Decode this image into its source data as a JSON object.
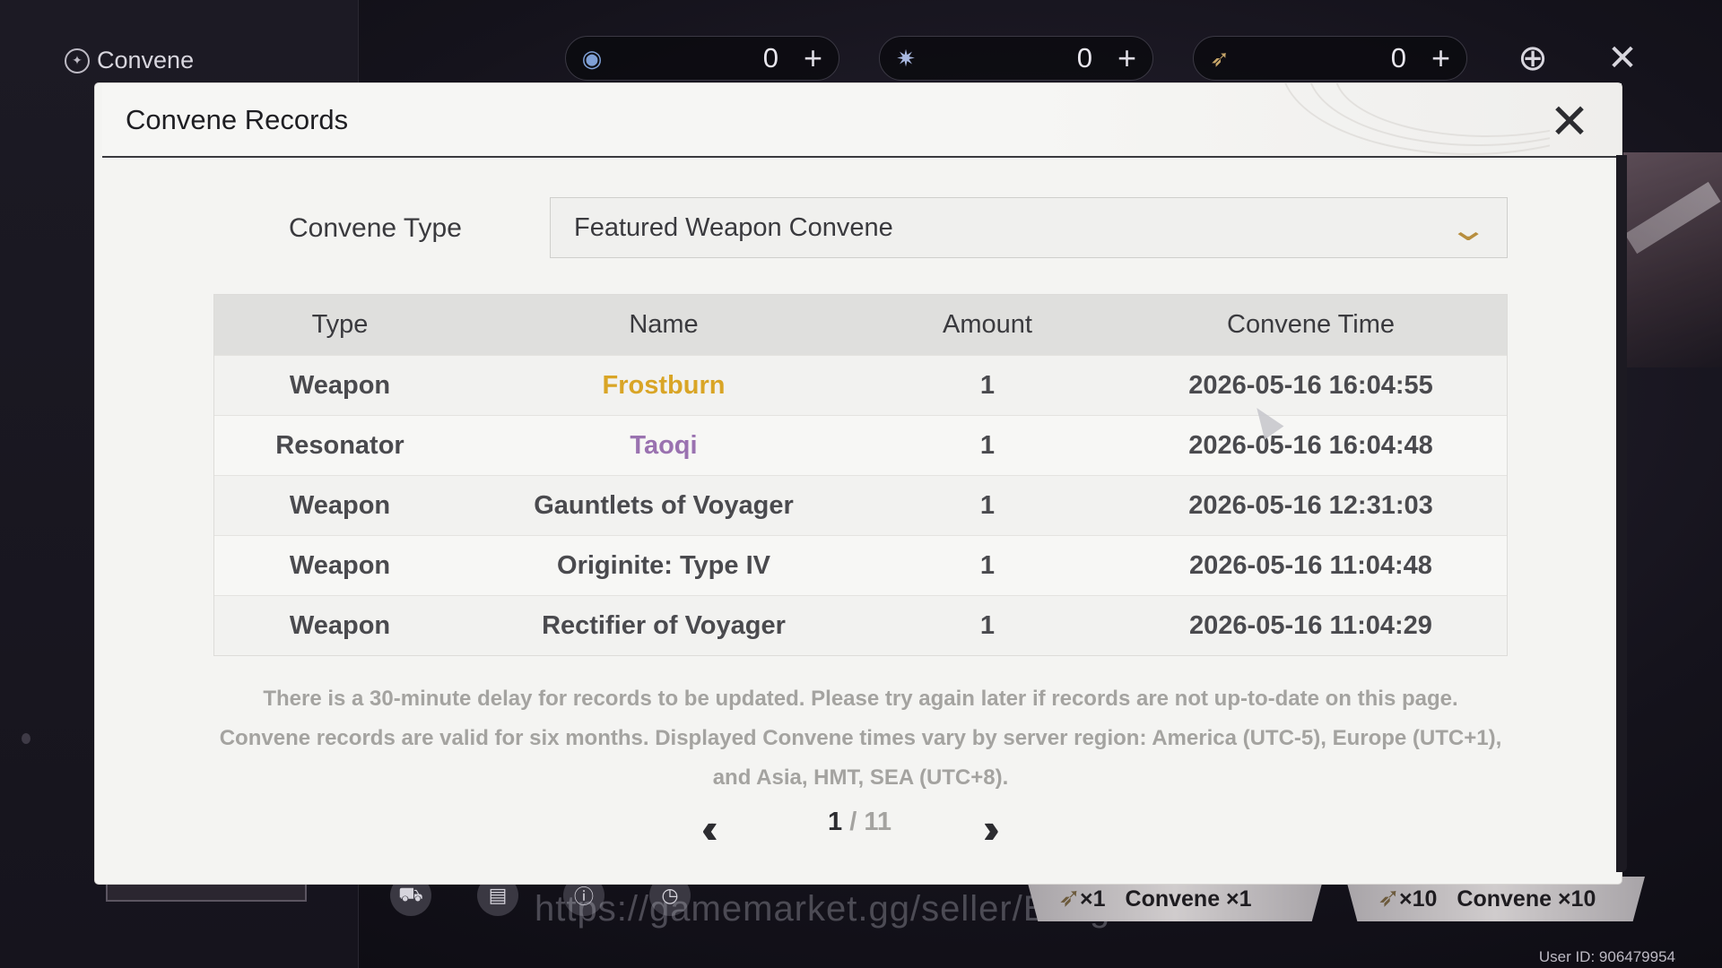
{
  "hud": {
    "title": "Convene",
    "currencies": [
      {
        "icon": "lunite-orb-icon",
        "value": "0",
        "plus": "+"
      },
      {
        "icon": "star-tide-icon",
        "value": "0",
        "plus": "+"
      },
      {
        "icon": "forging-tide-icon",
        "value": "0",
        "plus": "+"
      }
    ],
    "convene_x1": {
      "mult": "×1",
      "label": "Convene ×1"
    },
    "convene_x10": {
      "mult": "×10",
      "label": "Convene ×10"
    },
    "watermark": "https://gamemarket.gg/seller/BangJohn",
    "user_id": "User ID: 906479954"
  },
  "modal": {
    "title": "Convene Records",
    "convene_type_label": "Convene Type",
    "convene_type_value": "Featured Weapon Convene",
    "columns": [
      "Type",
      "Name",
      "Amount",
      "Convene Time"
    ],
    "rows": [
      {
        "type": "Weapon",
        "name": "Frostburn",
        "amount": "1",
        "time": "2026-05-16 16:04:55",
        "rarity_color": "#d9a526"
      },
      {
        "type": "Resonator",
        "name": "Taoqi",
        "amount": "1",
        "time": "2026-05-16 16:04:48",
        "rarity_color": "#9a72b0"
      },
      {
        "type": "Weapon",
        "name": "Gauntlets of Voyager",
        "amount": "1",
        "time": "2026-05-16 12:31:03",
        "rarity_color": "#4a4a4e"
      },
      {
        "type": "Weapon",
        "name": "Originite: Type IV",
        "amount": "1",
        "time": "2026-05-16 11:04:48",
        "rarity_color": "#4a4a4e"
      },
      {
        "type": "Weapon",
        "name": "Rectifier of Voyager",
        "amount": "1",
        "time": "2026-05-16 11:04:29",
        "rarity_color": "#4a4a4e"
      }
    ],
    "notice": [
      "There is a 30-minute delay for records to be updated. Please try again later if records are not up-to-date on this page.",
      "Convene records are valid for six months. Displayed Convene times vary by server region: America (UTC-5), Europe (UTC+1),",
      "and Asia, HMT, SEA (UTC+8)."
    ],
    "pager": {
      "current": "1",
      "separator": " / ",
      "total": "11"
    }
  }
}
